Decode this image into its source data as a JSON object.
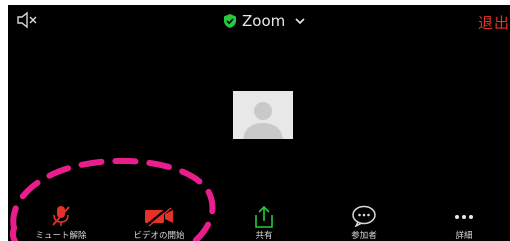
{
  "header": {
    "speaker_icon": "speaker-muted-icon",
    "app_title": "Zoom",
    "secure_icon": "shield-check-icon",
    "dropdown_icon": "chevron-down-icon",
    "leave_label": "退出"
  },
  "main": {
    "participant_avatar_icon": "person-silhouette-icon"
  },
  "toolbar": {
    "items": [
      {
        "label": "ミュート解除",
        "icon": "microphone-muted-icon"
      },
      {
        "label": "ビデオの開始",
        "icon": "video-camera-off-icon"
      },
      {
        "label": "共有",
        "icon": "share-upload-icon"
      },
      {
        "label": "参加者",
        "icon": "chat-bubble-icon"
      },
      {
        "label": "詳細",
        "icon": "more-dots-icon"
      }
    ]
  },
  "colors": {
    "background": "#000000",
    "leave_red": "#e4322b",
    "muted_red": "#e4322b",
    "share_green": "#27c93f",
    "annotation_pink": "#e91e8c"
  }
}
